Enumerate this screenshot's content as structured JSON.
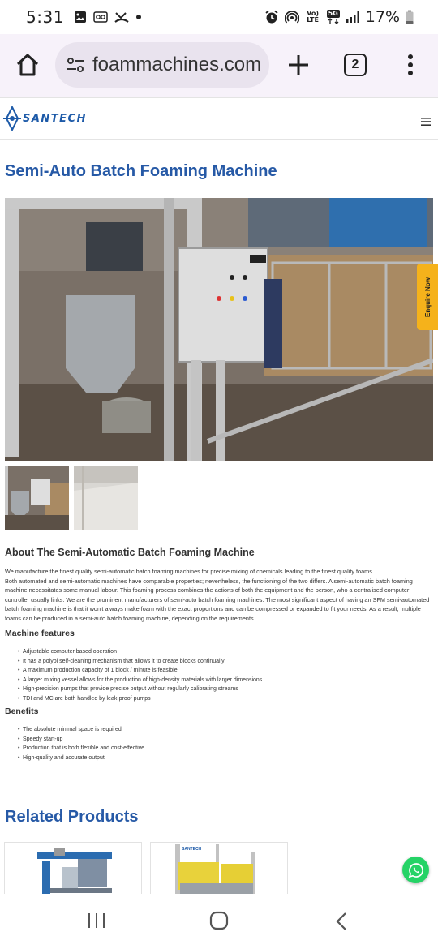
{
  "status_bar": {
    "time": "5:31",
    "battery": "17%",
    "network": "5G",
    "volte": "Vo) LTE"
  },
  "browser": {
    "url": "foammachines.com",
    "tab_count": "2"
  },
  "site": {
    "logo_text": "SANTECH"
  },
  "page": {
    "title": "Semi-Auto Batch Foaming Machine",
    "enquire_label": "Enquire Now"
  },
  "about": {
    "title": "About The Semi-Automatic Batch Foaming Machine",
    "paragraph_1": "We manufacture the finest quality semi-automatic batch foaming machines for precise mixing of chemicals leading to the finest quality foams.",
    "paragraph_2": "Both automated and semi-automatic machines have comparable properties; nevertheless, the functioning of the two differs. A semi-automatic batch foaming machine necessitates some manual labour. This foaming process combines the actions of both the equipment and the person, who a centralised computer controller usually links. We are the prominent manufacturers of semi-auto batch foaming machines. The most significant aspect of having an SFM semi-automated batch foaming machine is that it won't always make foam with the exact proportions and can be compressed or expanded to fit your needs. As a result, multiple foams can be produced in a semi-auto batch foaming machine, depending on the requirements."
  },
  "features": {
    "title": "Machine features",
    "items": [
      "Adjustable computer based operation",
      "It has a polyol self-cleaning mechanism that allows it to create blocks continually",
      "A maximum production capacity of 1 block / minute is feasible",
      "A larger mixing vessel allows for the production of high-density materials with larger dimensions",
      "High-precision pumps that provide precise output without regularly calibrating streams",
      "TDI and MC are both handled by leak-proof pumps"
    ]
  },
  "benefits": {
    "title": "Benefits",
    "items": [
      "The absolute minimal space is required",
      "Speedy start-up",
      "Production that is both flexible and cost-effective",
      "High-quality and accurate output"
    ]
  },
  "related": {
    "title": "Related Products",
    "card_2_logo": "SANTECH"
  },
  "colors": {
    "brand_blue": "#2659a6",
    "enquire_yellow": "#f5b21b",
    "whatsapp_green": "#25d366"
  }
}
